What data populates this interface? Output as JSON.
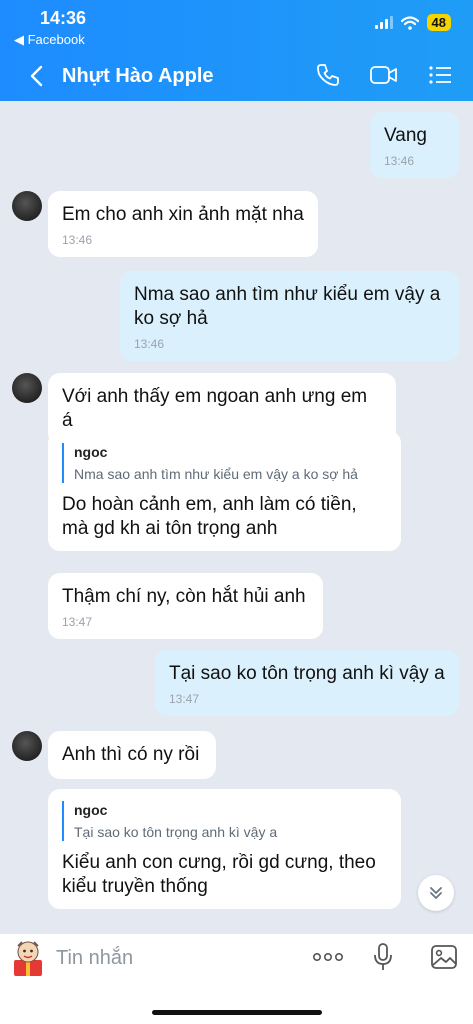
{
  "status": {
    "time": "14:36",
    "back_app": "◀ Facebook",
    "battery": "48"
  },
  "header": {
    "title": "Nhựt Hào Apple"
  },
  "messages": {
    "m1": {
      "text": "Vang",
      "time": "13:46"
    },
    "m2": {
      "text": "Em cho anh xin ảnh mặt nha",
      "time": "13:46"
    },
    "m3": {
      "line1": "Nma sao anh tìm như kiểu em vậy a",
      "line2": "ko sợ hả",
      "time": "13:46"
    },
    "m4": {
      "text": "Với anh thấy em ngoan anh ưng em á"
    },
    "m5": {
      "quote_name": "ngoc",
      "quote_text": "Nma sao anh tìm như kiểu em vậy a ko sợ hả",
      "line1": "Do hoàn cảnh em, anh làm có tiền,",
      "line2": "mà gd kh ai tôn trọng anh"
    },
    "m6": {
      "text": "Thậm chí ny, còn hắt hủi anh",
      "time": "13:47"
    },
    "m7": {
      "text": "Tại sao ko tôn trọng anh kì vậy a",
      "time": "13:47"
    },
    "m8": {
      "text": "Anh thì có ny rồi"
    },
    "m9": {
      "quote_name": "ngoc",
      "quote_text": "Tại sao ko tôn trọng anh kì vậy a",
      "line1": "Kiểu anh con cưng, rồi gd cưng, theo",
      "line2": "kiểu truyền thống"
    }
  },
  "input": {
    "placeholder": "Tin nhắn"
  },
  "colors": {
    "header": "#1e8cff",
    "my_bubble": "#daf1fd",
    "their_bubble": "#ffffff",
    "background": "#e4e8f0"
  }
}
